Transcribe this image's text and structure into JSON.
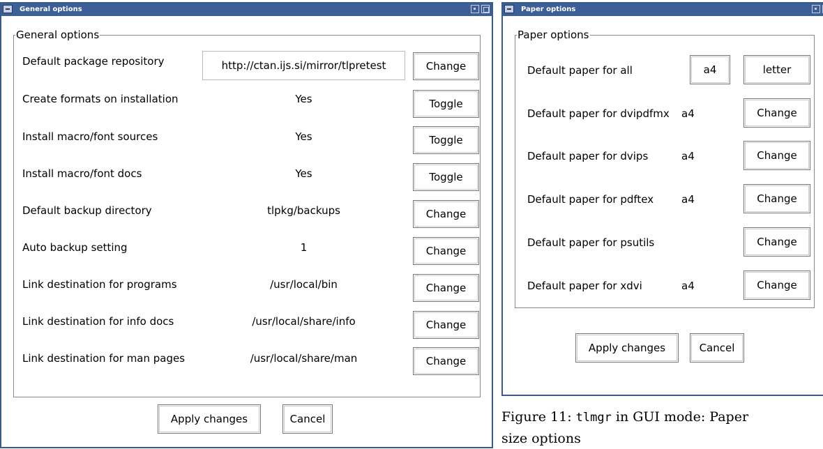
{
  "general_window": {
    "title": "General options",
    "group_title": "General options",
    "rows": [
      {
        "label": "Default package repository",
        "value": "http://ctan.ijs.si/mirror/tlpretest",
        "button": "Change"
      },
      {
        "label": "Create formats on installation",
        "value": "Yes",
        "button": "Toggle"
      },
      {
        "label": "Install macro/font sources",
        "value": "Yes",
        "button": "Toggle"
      },
      {
        "label": "Install macro/font docs",
        "value": "Yes",
        "button": "Toggle"
      },
      {
        "label": "Default backup directory",
        "value": "tlpkg/backups",
        "button": "Change"
      },
      {
        "label": "Auto backup setting",
        "value": "1",
        "button": "Change"
      },
      {
        "label": "Link destination for programs",
        "value": "/usr/local/bin",
        "button": "Change"
      },
      {
        "label": "Link destination for info docs",
        "value": "/usr/local/share/info",
        "button": "Change"
      },
      {
        "label": "Link destination for man pages",
        "value": "/usr/local/share/man",
        "button": "Change"
      }
    ],
    "apply_label": "Apply changes",
    "cancel_label": "Cancel"
  },
  "paper_window": {
    "title": "Paper options",
    "group_title": "Paper options",
    "all_row": {
      "label": "Default paper for all",
      "option_a4": "a4",
      "option_letter": "letter"
    },
    "rows": [
      {
        "label": "Default paper for dvipdfmx",
        "value": "a4",
        "button": "Change"
      },
      {
        "label": "Default paper for dvips",
        "value": "a4",
        "button": "Change"
      },
      {
        "label": "Default paper for pdftex",
        "value": "a4",
        "button": "Change"
      },
      {
        "label": "Default paper for psutils",
        "value": "",
        "button": "Change"
      },
      {
        "label": "Default paper for xdvi",
        "value": "a4",
        "button": "Change"
      }
    ],
    "apply_label": "Apply changes",
    "cancel_label": "Cancel"
  },
  "caption": {
    "figure": "Figure 11:",
    "command": "tlmgr",
    "text_line1": "in GUI mode: Paper",
    "text_line2": "size options"
  },
  "colors": {
    "titlebar": "#3b5f96",
    "window_border": "#3a5a8c",
    "frame_border": "#888888"
  }
}
